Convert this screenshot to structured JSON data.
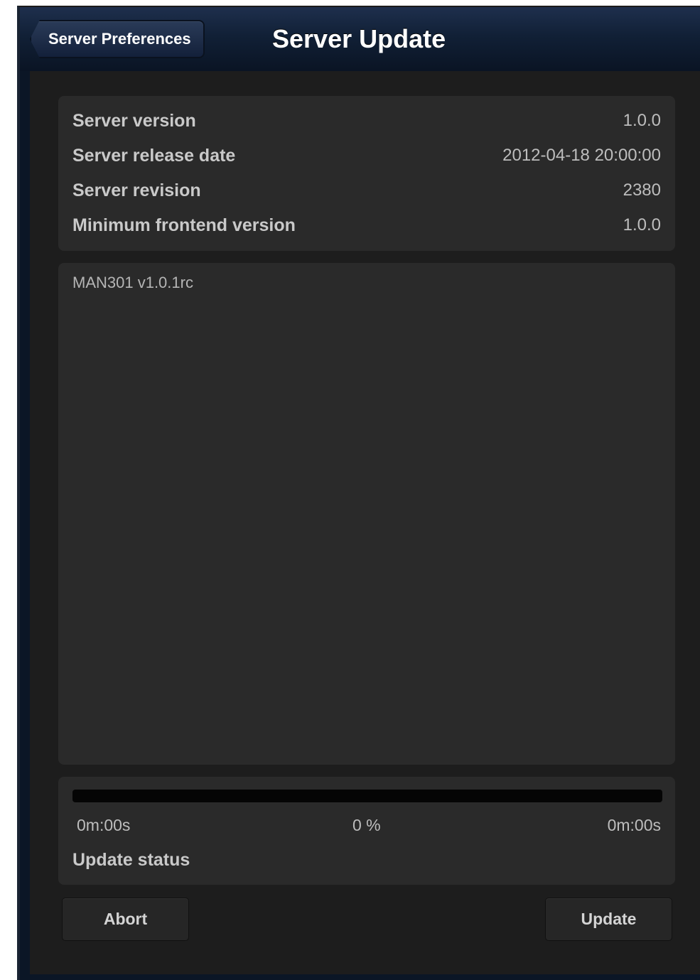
{
  "navbar": {
    "back_label": "Server Preferences",
    "title": "Server Update"
  },
  "server_info": [
    {
      "label": "Server version",
      "value": "1.0.0"
    },
    {
      "label": "Server release date",
      "value": "2012-04-18 20:00:00"
    },
    {
      "label": "Server revision",
      "value": "2380"
    },
    {
      "label": "Minimum frontend version",
      "value": "1.0.0"
    }
  ],
  "release_notes": {
    "text": "MAN301 v1.0.1rc"
  },
  "progress": {
    "fraction": 0,
    "elapsed": "0m:00s",
    "percent_label": "0 %",
    "remaining": "0m:00s",
    "status": "Update status"
  },
  "actions": {
    "abort_label": "Abort",
    "update_label": "Update"
  },
  "colors": {
    "navbar": "#112036",
    "panel": "#2a2a2a",
    "background": "#1d1d1d"
  }
}
